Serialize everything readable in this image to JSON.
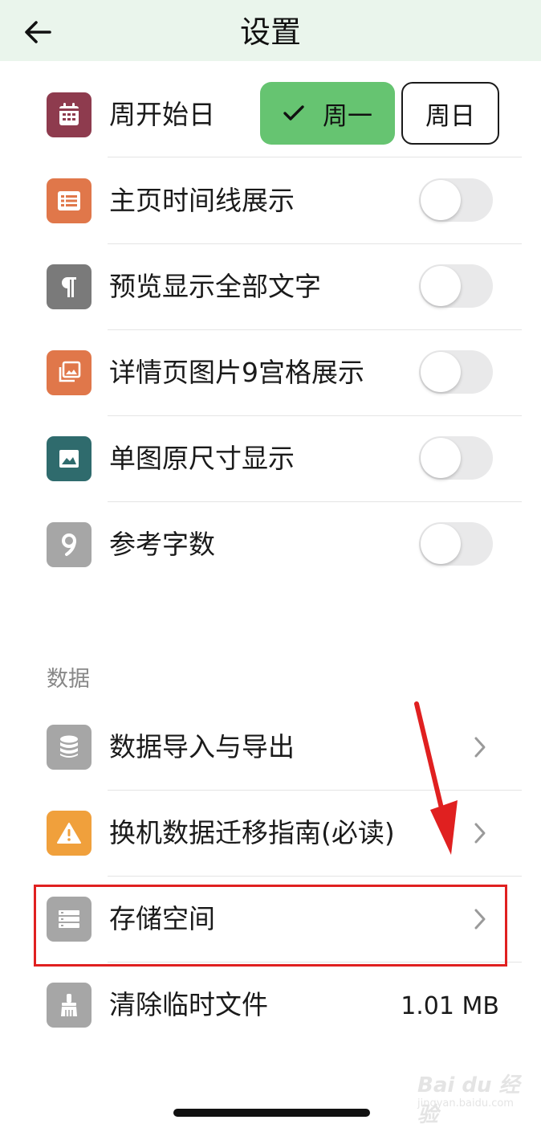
{
  "header": {
    "title": "设置",
    "back_icon": "arrow-left-icon"
  },
  "week_start": {
    "label": "周开始日",
    "icon": "calendar-icon",
    "icon_color": "#8e3b4e",
    "options": [
      "周一",
      "周日"
    ],
    "selected": "周一",
    "selected_color": "#66c471"
  },
  "display_settings": [
    {
      "label": "主页时间线展示",
      "icon": "list-icon",
      "icon_color": "#e0774a",
      "enabled": false
    },
    {
      "label": "预览显示全部文字",
      "icon": "pilcrow-icon",
      "icon_color": "#7a7a7a",
      "enabled": false
    },
    {
      "label": "详情页图片9宫格展示",
      "icon": "photo-gallery-icon",
      "icon_color": "#e0774a",
      "enabled": false
    },
    {
      "label": "单图原尺寸显示",
      "icon": "image-icon",
      "icon_color": "#2f6b6d",
      "enabled": false
    },
    {
      "label": "参考字数",
      "icon": "nine-icon",
      "icon_color": "#a6a6a6",
      "enabled": false
    }
  ],
  "data_section": {
    "title": "数据",
    "items": [
      {
        "label": "数据导入与导出",
        "icon": "database-icon",
        "icon_color": "#a6a6a6"
      },
      {
        "label": "换机数据迁移指南(必读)",
        "icon": "warning-icon",
        "icon_color": "#f0a03c"
      },
      {
        "label": "存储空间",
        "icon": "storage-icon",
        "icon_color": "#a6a6a6"
      },
      {
        "label": "清除临时文件",
        "icon": "brush-icon",
        "icon_color": "#a6a6a6",
        "value": "1.01 MB"
      }
    ]
  },
  "annotation": {
    "highlight_color": "#e02020"
  },
  "watermark": {
    "line1": "Bai du 经验",
    "line2": "jingyan.baidu.com"
  }
}
